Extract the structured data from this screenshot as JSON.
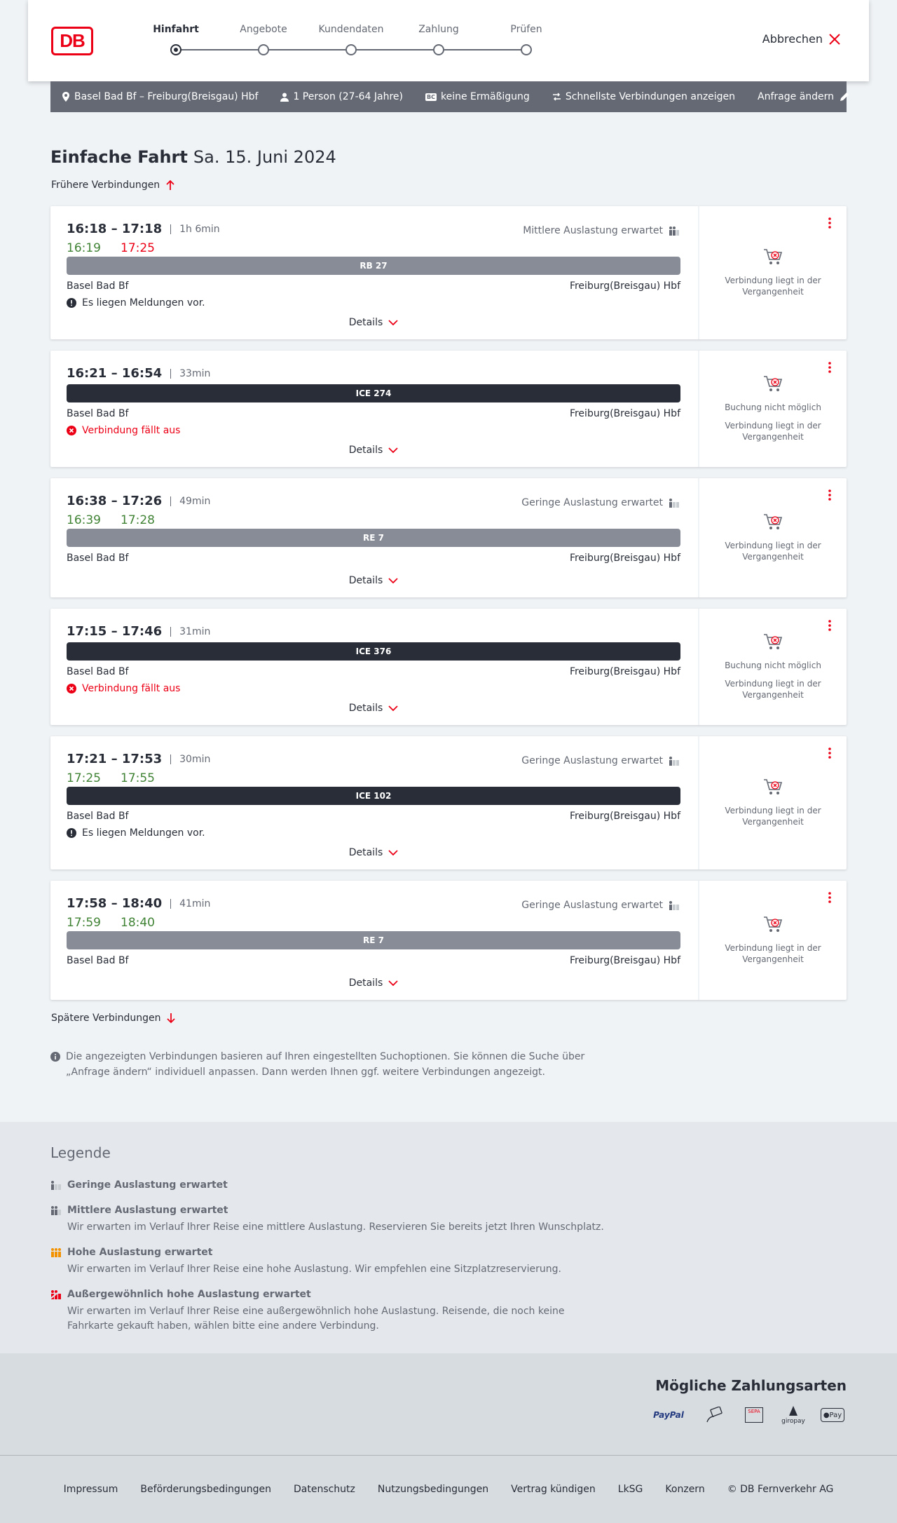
{
  "header": {
    "logo": "DB",
    "steps": [
      "Hinfahrt",
      "Angebote",
      "Kundendaten",
      "Zahlung",
      "Prüfen"
    ],
    "active_step": 0,
    "cancel_label": "Abbrechen"
  },
  "summary": {
    "route": "Basel Bad Bf – Freiburg(Breisgau) Hbf",
    "passengers": "1 Person (27-64 Jahre)",
    "discount_badge": "BC",
    "discount": "keine Ermäßigung",
    "option": "Schnellste Verbindungen anzeigen",
    "change_label": "Anfrage ändern"
  },
  "title": {
    "type": "Einfache Fahrt",
    "date": "Sa. 15. Juni 2024"
  },
  "earlier_label": "Frühere Verbindungen",
  "later_label": "Spätere Verbindungen",
  "connections": [
    {
      "times": "16:18 – 17:18",
      "duration": "1h 6min",
      "rt_dep": "16:19",
      "rt_arr": "17:25",
      "load": "Mittlere Auslastung erwartet",
      "train": "RB 27",
      "from": "Basel Bad Bf",
      "to": "Freiburg(Breisgau) Hbf",
      "message": "Es liegen Meldungen vor.",
      "details": "Details",
      "status": [
        "Verbindung liegt in der Vergangenheit"
      ]
    },
    {
      "times": "16:21 – 16:54",
      "duration": "33min",
      "train": "ICE 274",
      "from": "Basel Bad Bf",
      "to": "Freiburg(Breisgau) Hbf",
      "cancel_message": "Verbindung fällt aus",
      "details": "Details",
      "status": [
        "Buchung nicht möglich",
        "Verbindung liegt in der Vergangenheit"
      ]
    },
    {
      "times": "16:38 – 17:26",
      "duration": "49min",
      "rt_dep": "16:39",
      "rt_arr": "17:28",
      "load": "Geringe Auslastung erwartet",
      "train": "RE 7",
      "from": "Basel Bad Bf",
      "to": "Freiburg(Breisgau) Hbf",
      "details": "Details",
      "status": [
        "Verbindung liegt in der Vergangenheit"
      ]
    },
    {
      "times": "17:15 – 17:46",
      "duration": "31min",
      "train": "ICE 376",
      "from": "Basel Bad Bf",
      "to": "Freiburg(Breisgau) Hbf",
      "cancel_message": "Verbindung fällt aus",
      "details": "Details",
      "status": [
        "Buchung nicht möglich",
        "Verbindung liegt in der Vergangenheit"
      ]
    },
    {
      "times": "17:21 – 17:53",
      "duration": "30min",
      "rt_dep": "17:25",
      "rt_arr": "17:55",
      "load": "Geringe Auslastung erwartet",
      "train": "ICE 102",
      "from": "Basel Bad Bf",
      "to": "Freiburg(Breisgau) Hbf",
      "message": "Es liegen Meldungen vor.",
      "details": "Details",
      "status": [
        "Verbindung liegt in der Vergangenheit"
      ]
    },
    {
      "times": "17:58 – 18:40",
      "duration": "41min",
      "rt_dep": "17:59",
      "rt_arr": "18:40",
      "load": "Geringe Auslastung erwartet",
      "train": "RE 7",
      "from": "Basel Bad Bf",
      "to": "Freiburg(Breisgau) Hbf",
      "details": "Details",
      "status": [
        "Verbindung liegt in der Vergangenheit"
      ]
    }
  ],
  "info": "Die angezeigten Verbindungen basieren auf Ihren eingestellten Suchoptionen. Sie können die Suche über „Anfrage ändern“ individuell anpassen. Dann werden Ihnen ggf. weitere Verbindungen angezeigt.",
  "legend": {
    "title": "Legende",
    "items": [
      {
        "title": "Geringe Auslastung erwartet",
        "desc": ""
      },
      {
        "title": "Mittlere Auslastung erwartet",
        "desc": "Wir erwarten im Verlauf Ihrer Reise eine mittlere Auslastung. Reservieren Sie bereits jetzt Ihren Wunschplatz."
      },
      {
        "title": "Hohe Auslastung erwartet",
        "desc": "Wir erwarten im Verlauf Ihrer Reise eine hohe Auslastung. Wir empfehlen eine Sitzplatzreservierung."
      },
      {
        "title": "Außergewöhnlich hohe Auslastung erwartet",
        "desc": "Wir erwarten im Verlauf Ihrer Reise eine außergewöhnlich hohe Auslastung. Reisende, die noch keine Fahrkarte gekauft haben, wählen bitte eine andere Verbindung."
      }
    ]
  },
  "payment": {
    "title": "Mögliche Zahlungsarten",
    "methods": [
      "PayPal",
      "SEPA",
      "giropay",
      "Pay"
    ]
  },
  "footer": [
    "Impressum",
    "Beförderungsbedingungen",
    "Datenschutz",
    "Nutzungsbedingungen",
    "Vertrag kündigen",
    "LkSG",
    "Konzern",
    "© DB Fernverkehr AG"
  ],
  "colors": {
    "red": "#ec0016",
    "green": "#408335",
    "dark": "#282d37",
    "grey": "#646973",
    "orange": "#f39200"
  }
}
